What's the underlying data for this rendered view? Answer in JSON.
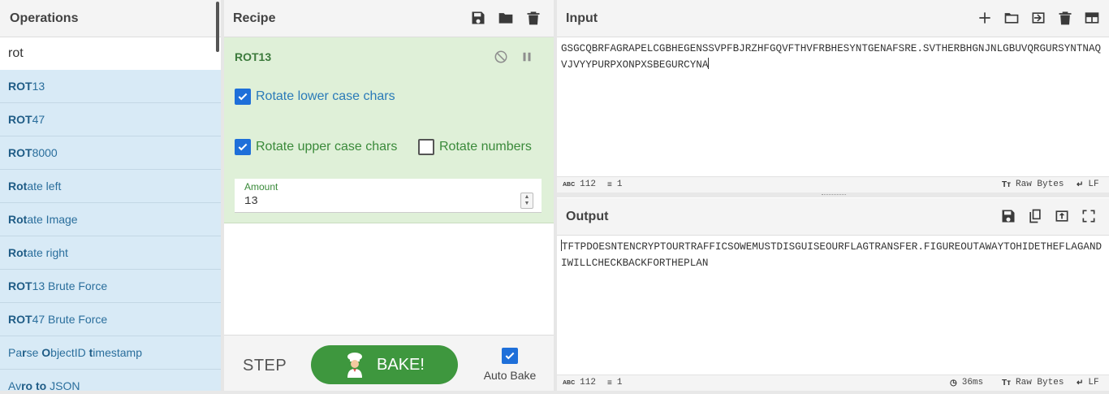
{
  "operations": {
    "title": "Operations",
    "search_value": "rot",
    "items": [
      {
        "hl": "ROT",
        "rest": "13"
      },
      {
        "hl": "ROT",
        "rest": "47"
      },
      {
        "hl": "ROT",
        "rest": "8000"
      },
      {
        "hl": "Rot",
        "rest": "ate left"
      },
      {
        "hl": "Rot",
        "rest": "ate Image"
      },
      {
        "hl": "Rot",
        "rest": "ate right"
      },
      {
        "hl": "ROT",
        "rest": "13 Brute Force"
      },
      {
        "hl": "ROT",
        "rest": "47 Brute Force"
      },
      {
        "segments": [
          [
            "Pa",
            0
          ],
          [
            "r",
            1
          ],
          [
            "se ",
            0
          ],
          [
            "O",
            1
          ],
          [
            "bjectID ",
            0
          ],
          [
            "t",
            1
          ],
          [
            "imestamp",
            0
          ]
        ]
      },
      {
        "segments": [
          [
            "Av",
            0
          ],
          [
            "ro",
            1
          ],
          [
            " ",
            0
          ],
          [
            "t",
            1
          ],
          [
            "o",
            1
          ],
          [
            " JSON",
            0
          ]
        ]
      }
    ]
  },
  "recipe": {
    "title": "Recipe",
    "icons": [
      "save-icon",
      "folder-open-icon",
      "trash-icon"
    ],
    "operation": {
      "name": "ROT13",
      "rotate_lower_label": "Rotate lower case chars",
      "rotate_lower_checked": true,
      "rotate_upper_label": "Rotate upper case chars",
      "rotate_upper_checked": true,
      "rotate_numbers_label": "Rotate numbers",
      "rotate_numbers_checked": false,
      "amount_label": "Amount",
      "amount_value": "13"
    },
    "step_label": "STEP",
    "bake_label": "BAKE!",
    "auto_bake_label": "Auto Bake",
    "auto_bake_checked": true
  },
  "input": {
    "title": "Input",
    "text": "GSGCQBRFAGRAPELCGBHEGENSSVPFBJRZHFGQVFTHVFRBHESYNTGENAFSRE.SVTHERBHGNJNLGBUVQRGURSYNTNAQVJVYYPURPXONPXSBEGURCYNA",
    "char_count": "112",
    "line_count": "1",
    "encoding": "Raw Bytes",
    "eol": "LF"
  },
  "output": {
    "title": "Output",
    "text": "TFTPDOESNTENCRYPTOURTRAFFICSOWEMUSTDISGUISEOURFLAGTRANSFER.FIGUREOUTAWAYTOHIDETHEFLAGANDIWILLCHECKBACKFORTHEPLAN",
    "char_count": "112",
    "line_count": "1",
    "time": "36ms",
    "encoding": "Raw Bytes",
    "eol": "LF"
  },
  "colors": {
    "accent_green": "#3e973e",
    "op_card_bg": "#dff0d8",
    "op_list_bg": "#d8eaf6",
    "checkbox_blue": "#1e6fd9"
  }
}
